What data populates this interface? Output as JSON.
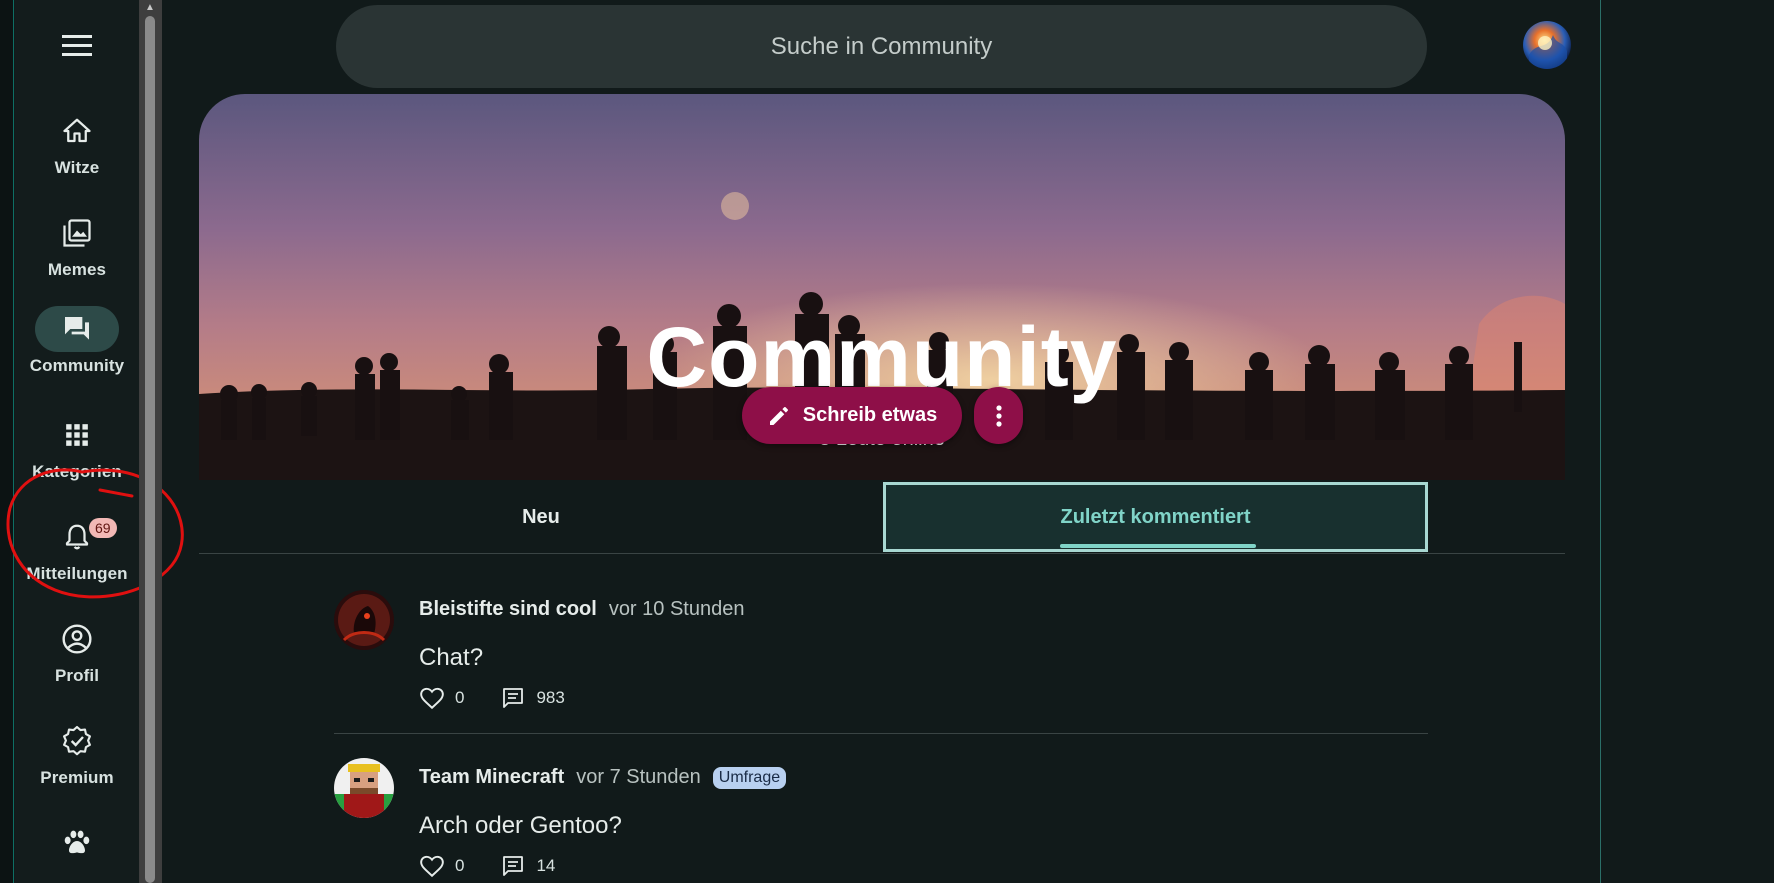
{
  "search": {
    "placeholder": "Suche in Community"
  },
  "nav": {
    "items": [
      {
        "label": "Witze",
        "icon": "home-icon"
      },
      {
        "label": "Memes",
        "icon": "image-library-icon"
      },
      {
        "label": "Community",
        "icon": "forum-icon",
        "active": true
      },
      {
        "label": "Kategorien",
        "icon": "grid-icon"
      },
      {
        "label": "Mitteilungen",
        "icon": "bell-icon",
        "badge": "69"
      },
      {
        "label": "Profil",
        "icon": "account-circle-icon"
      },
      {
        "label": "Premium",
        "icon": "verified-badge-icon"
      },
      {
        "label": "",
        "icon": "paw-icon"
      }
    ]
  },
  "hero": {
    "title": "Community",
    "subtitle": "3 Leute online",
    "write_label": "Schreib etwas"
  },
  "tabs": [
    {
      "label": "Neu"
    },
    {
      "label": "Zuletzt kommentiert",
      "selected": true
    }
  ],
  "posts": [
    {
      "author": "Bleistifte sind cool",
      "time": "vor 10 Stunden",
      "tag": "",
      "text": "Chat?",
      "likes": "0",
      "comments": "983"
    },
    {
      "author": "Team Minecraft",
      "time": "vor 7 Stunden",
      "tag": "Umfrage",
      "text": "Arch oder Gentoo?",
      "likes": "0",
      "comments": "14"
    }
  ],
  "colors": {
    "accent": "#80d4c8",
    "primary_button": "#8e0f48",
    "background": "#111a1a",
    "annotation": "#e01010"
  }
}
